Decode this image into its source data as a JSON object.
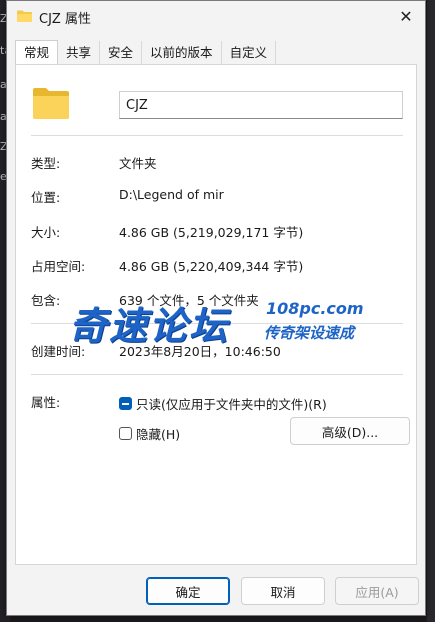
{
  "background": {
    "left_chars": [
      "Z",
      "ta",
      "ap",
      "av",
      "Z",
      "ev"
    ]
  },
  "window": {
    "title": "CJZ 属性",
    "close_glyph": "✕"
  },
  "tabs": [
    {
      "label": "常规",
      "active": true
    },
    {
      "label": "共享",
      "active": false
    },
    {
      "label": "安全",
      "active": false
    },
    {
      "label": "以前的版本",
      "active": false
    },
    {
      "label": "自定义",
      "active": false
    }
  ],
  "general": {
    "name": "CJZ",
    "type_label": "类型:",
    "type_value": "文件夹",
    "location_label": "位置:",
    "location_value": "D:\\Legend of mir",
    "size_label": "大小:",
    "size_value": "4.86 GB (5,219,029,171 字节)",
    "disk_size_label": "占用空间:",
    "disk_size_value": "4.86 GB (5,220,409,344 字节)",
    "contains_label": "包含:",
    "contains_value": "639 个文件，5 个文件夹",
    "created_label": "创建时间:",
    "created_value": "2023年8月20日，10:46:50",
    "attributes_label": "属性:",
    "readonly_label": "只读(仅应用于文件夹中的文件)(R)",
    "hidden_label": "隐藏(H)",
    "advanced_label": "高级(D)..."
  },
  "watermark": {
    "main": "奇速论坛",
    "domain": "108pc.com",
    "sub": "传奇架设速成"
  },
  "footer": {
    "ok_label": "确定",
    "cancel_label": "取消",
    "apply_label": "应用(A)"
  },
  "colors": {
    "accent": "#005fb8",
    "watermark": "#1e63c6",
    "folder": "#f7c948"
  }
}
